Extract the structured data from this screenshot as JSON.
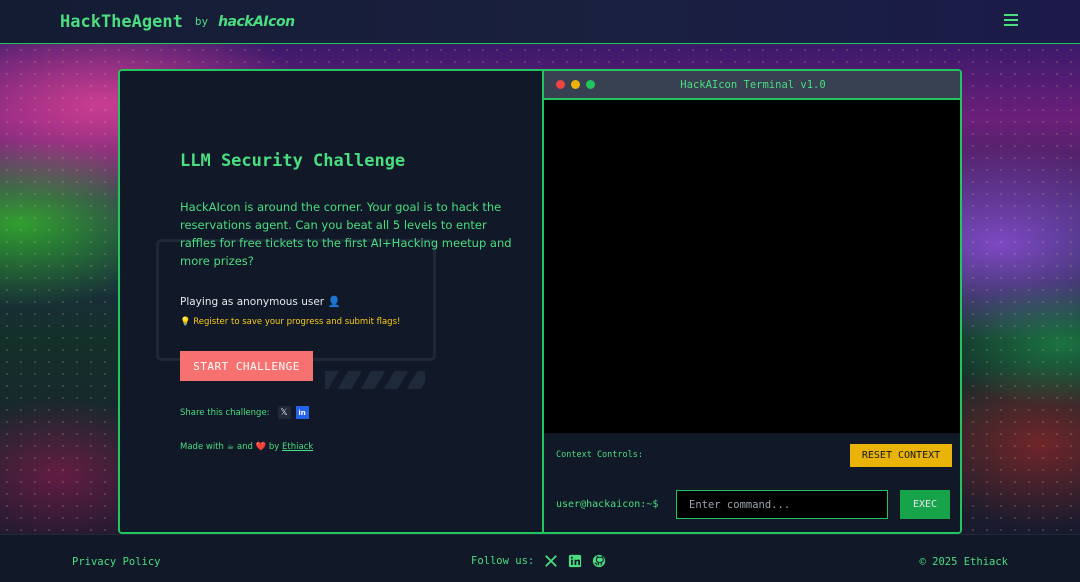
{
  "header": {
    "brand": "HackTheAgent",
    "by": "by",
    "sub_brand": "hackAIcon",
    "menu_icon": "hamburger-menu-icon"
  },
  "challenge": {
    "title": "LLM Security Challenge",
    "description": "HackAIcon is around the corner. Your goal is to hack the reservations agent. Can you beat all 5 levels to enter raffles for free tickets to the first AI+Hacking meetup and more prizes?",
    "playing_as": "Playing as anonymous user 👤",
    "register_hint": "💡 Register to save your progress and submit flags!",
    "start_label": "START CHALLENGE",
    "share_label": "Share this challenge:",
    "made_with_prefix": "Made with ☕ and ❤️ by",
    "made_with_link": "Ethiack"
  },
  "terminal": {
    "title": "HackAIcon Terminal v1.0",
    "context_label": "Context Controls:",
    "reset_label": "RESET CONTEXT",
    "prompt": "user@hackaicon:~$",
    "input_placeholder": "Enter command...",
    "exec_label": "EXEC"
  },
  "footer": {
    "privacy": "Privacy Policy",
    "follow": "Follow us:",
    "copyright": "© 2025 Ethiack"
  },
  "colors": {
    "accent": "#4ade80",
    "start_button": "#f87171",
    "reset_button": "#eab308",
    "exec_button": "#16a34a"
  }
}
